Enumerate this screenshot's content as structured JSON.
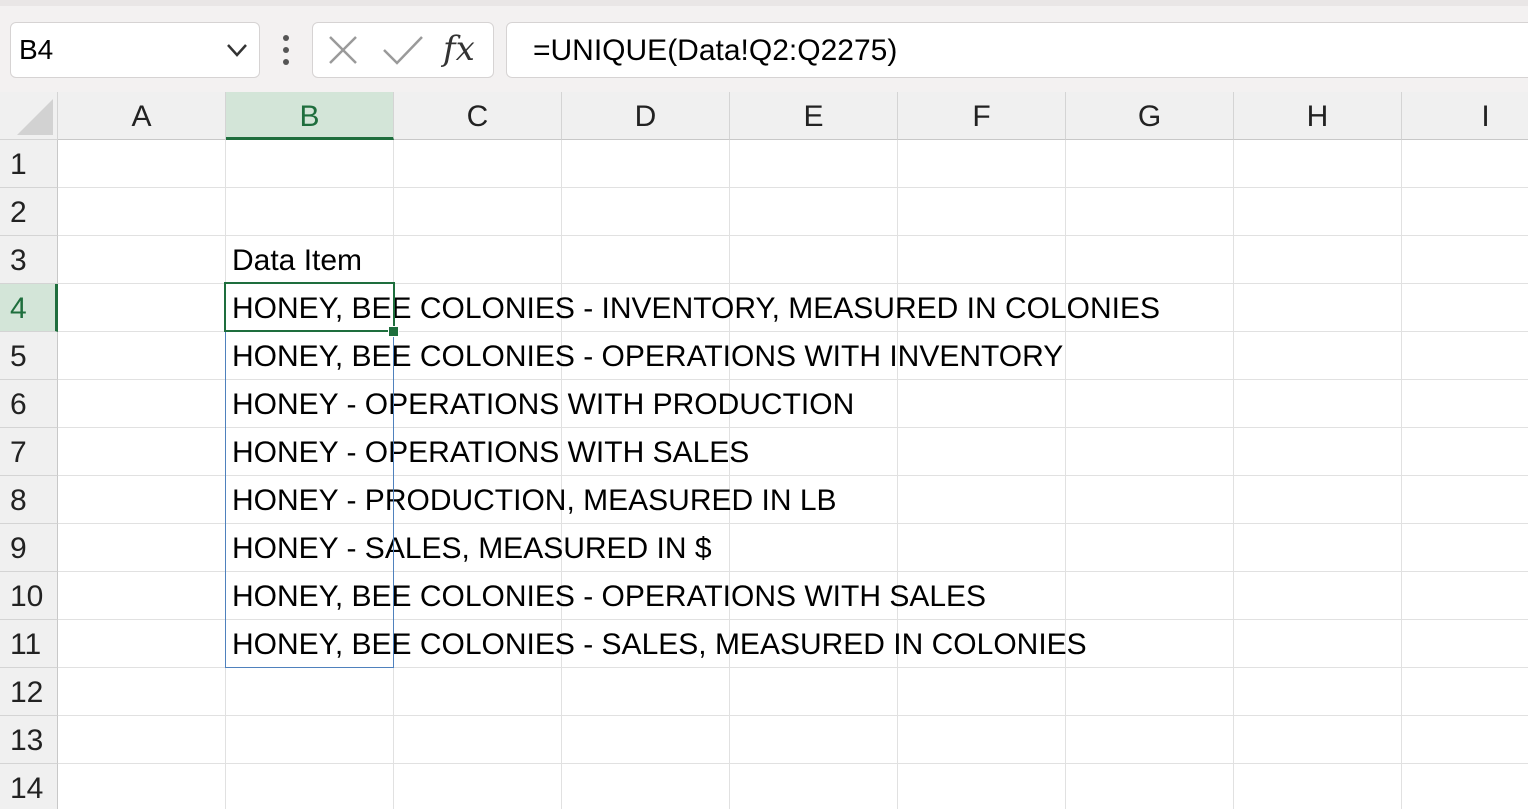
{
  "name_box": {
    "value": "B4",
    "dropdown_icon": "chevron-down-icon"
  },
  "formula_bar": {
    "options_icon": "vertical-dots-icon",
    "cancel_icon": "x-icon",
    "enter_icon": "checkmark-icon",
    "insert_function_label": "fx",
    "formula": "=UNIQUE(Data!Q2:Q2275)"
  },
  "columns": [
    "A",
    "B",
    "C",
    "D",
    "E",
    "F",
    "G",
    "H",
    "I"
  ],
  "rows": [
    "1",
    "2",
    "3",
    "4",
    "5",
    "6",
    "7",
    "8",
    "9",
    "10",
    "11",
    "12",
    "13",
    "14"
  ],
  "selected_column": "B",
  "selected_row": "4",
  "cells": {
    "B3": "Data Item",
    "B4": "HONEY, BEE COLONIES - INVENTORY, MEASURED IN COLONIES",
    "B5": "HONEY, BEE COLONIES - OPERATIONS WITH INVENTORY",
    "B6": "HONEY - OPERATIONS WITH PRODUCTION",
    "B7": "HONEY - OPERATIONS WITH SALES",
    "B8": "HONEY - PRODUCTION, MEASURED IN LB",
    "B9": "HONEY - SALES, MEASURED IN $",
    "B10": "HONEY, BEE COLONIES - OPERATIONS WITH SALES",
    "B11": "HONEY, BEE COLONIES - SALES, MEASURED IN COLONIES"
  },
  "colors": {
    "selection_green": "#1e6e3d",
    "header_highlight": "#d3e5d8",
    "spill_border": "#4f81bd"
  }
}
